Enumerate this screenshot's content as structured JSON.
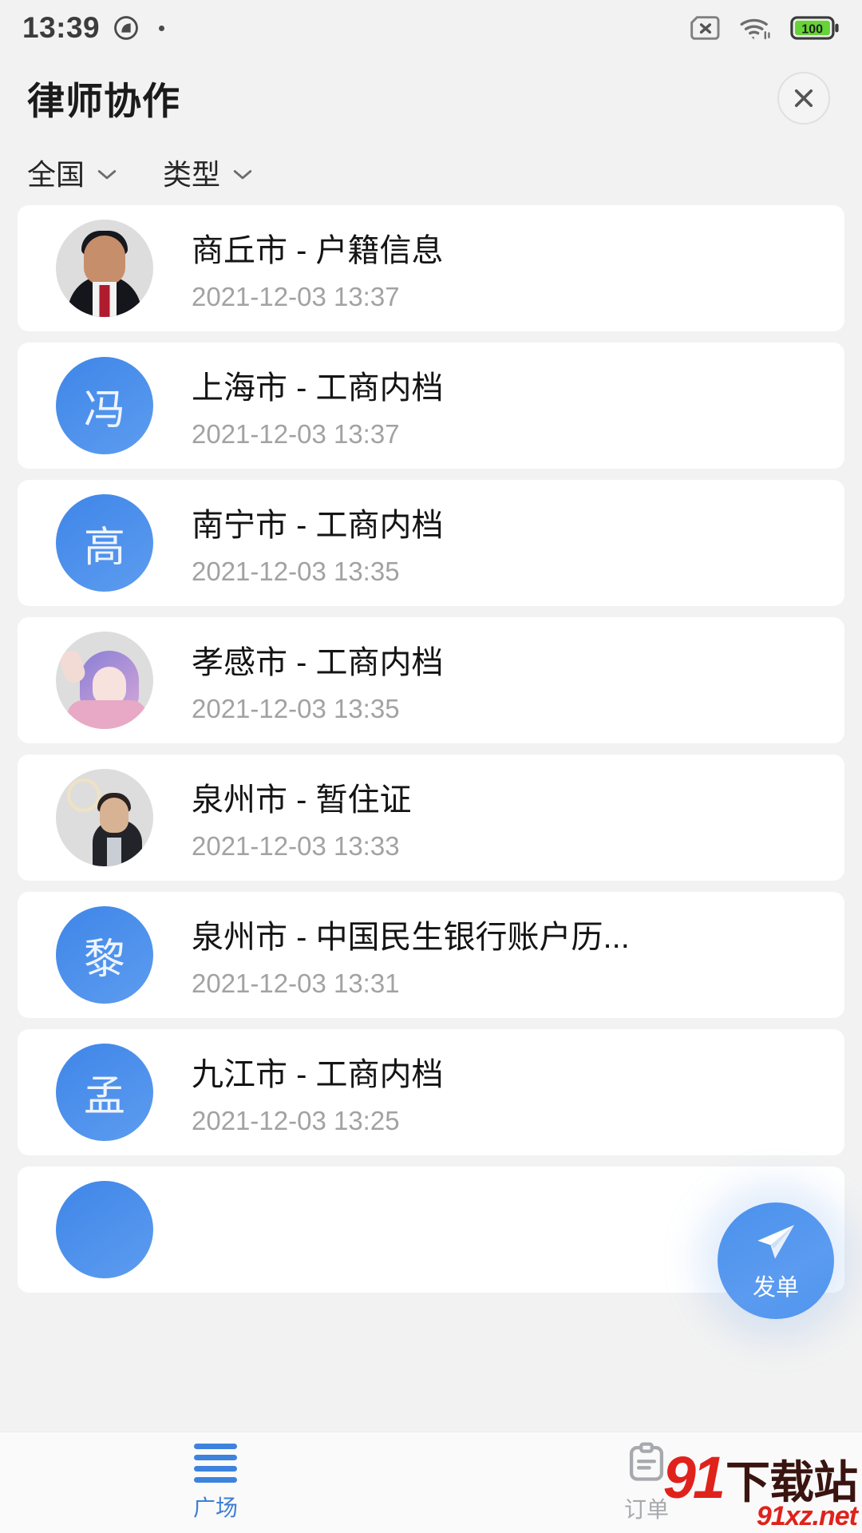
{
  "status_bar": {
    "time": "13:39",
    "left_icons": [
      "camera-privacy-icon",
      "dot-indicator"
    ],
    "right_icons": [
      "sim-card-disabled-icon",
      "wifi-icon",
      "battery-icon"
    ],
    "battery_level": "100",
    "battery_color": "#4caf50"
  },
  "header": {
    "title": "律师协作",
    "close_label": "✕"
  },
  "filters": [
    {
      "label": "全国",
      "icon": "chevron-down-icon"
    },
    {
      "label": "类型",
      "icon": "chevron-down-icon"
    }
  ],
  "list": {
    "items": [
      {
        "title": "商丘市 - 户籍信息",
        "time": "2021-12-03 13:37",
        "avatar_type": "photo",
        "avatar_style": "ph-red",
        "initial": ""
      },
      {
        "title": "上海市 - 工商内档",
        "time": "2021-12-03 13:37",
        "avatar_type": "initial",
        "avatar_style": "",
        "initial": "冯"
      },
      {
        "title": "南宁市 - 工商内档",
        "time": "2021-12-03 13:35",
        "avatar_type": "initial",
        "avatar_style": "",
        "initial": "高"
      },
      {
        "title": "孝感市 - 工商内档",
        "time": "2021-12-03 13:35",
        "avatar_type": "photo",
        "avatar_style": "ph-pink",
        "initial": ""
      },
      {
        "title": "泉州市 - 暂住证",
        "time": "2021-12-03 13:33",
        "avatar_type": "photo",
        "avatar_style": "ph-gold",
        "initial": ""
      },
      {
        "title": "泉州市 - 中国民生银行账户历...",
        "time": "2021-12-03 13:31",
        "avatar_type": "initial",
        "avatar_style": "",
        "initial": "黎"
      },
      {
        "title": "九江市 - 工商内档",
        "time": "2021-12-03 13:25",
        "avatar_type": "initial",
        "avatar_style": "",
        "initial": "孟"
      },
      {
        "title": "",
        "time": "",
        "avatar_type": "initial",
        "avatar_style": "",
        "initial": ""
      }
    ]
  },
  "fab": {
    "label": "发单",
    "icon": "send-paper-plane-icon",
    "color": "#4a91ec"
  },
  "bottom_nav": {
    "items": [
      {
        "label": "广场",
        "icon": "list-lines-icon",
        "active": true
      },
      {
        "label": "订单",
        "icon": "clipboard-icon",
        "active": false
      }
    ],
    "active_color": "#3d7fd6",
    "inactive_color": "#a7a9ad"
  },
  "watermark": {
    "number": "91",
    "chinese": "下载站",
    "url": "91xz.net",
    "red": "#e0221c"
  }
}
